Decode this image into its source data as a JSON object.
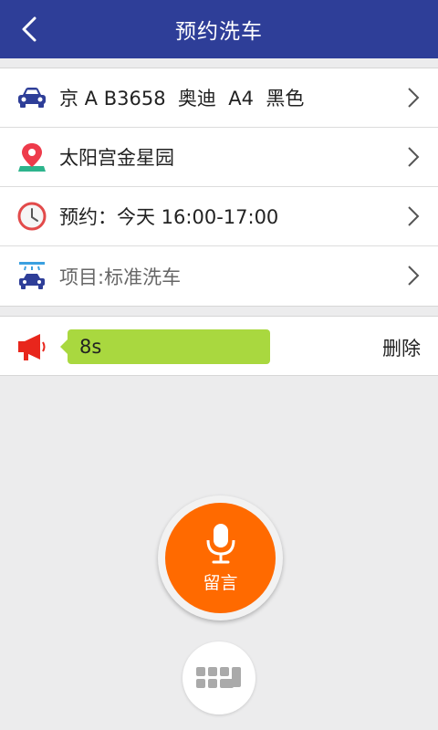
{
  "header": {
    "title": "预约洗车",
    "back_icon": "chevron-left-icon"
  },
  "rows": [
    {
      "icon": "car-icon",
      "label": "京 A B3658  奥迪  A4  黑色"
    },
    {
      "icon": "location-pin-icon",
      "label": "太阳宫金星园"
    },
    {
      "icon": "clock-icon",
      "label": "预约：今天 16:00-17:00"
    },
    {
      "icon": "car-wash-icon",
      "label": "项目:标准洗车"
    }
  ],
  "voice_message": {
    "duration": "8s",
    "delete_label": "删除"
  },
  "record_button": {
    "label": "留言"
  },
  "colors": {
    "header": "#2e3e98",
    "accent": "#ff6a00",
    "bubble": "#a9d83f"
  }
}
